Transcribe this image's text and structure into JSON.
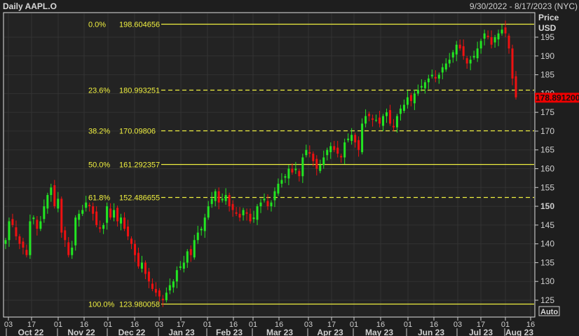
{
  "header": {
    "title": "Daily AAPL.O",
    "date_range": "9/30/2022 - 8/17/2023 (NYC)"
  },
  "price_axis": {
    "label": "Price",
    "currency": "USD",
    "auto_button": "Auto"
  },
  "colors": {
    "up": "#22e622",
    "down": "#ee1111",
    "fib_line": "#f0f040",
    "last_price_bg": "#ee0000"
  },
  "chart_data": {
    "type": "candlestick",
    "title": "Daily AAPL.O",
    "ylabel": "Price USD",
    "ylim": [
      123,
      199.5
    ],
    "y_ticks": [
      "125",
      "130",
      "135",
      "140",
      "145",
      "150",
      "155",
      "160",
      "165",
      "170",
      "175",
      "180",
      "185",
      "190",
      "195"
    ],
    "last_price": "178.891200",
    "fib_levels": [
      {
        "pct": "0.0%",
        "value": "198.604656",
        "price": 198.604656,
        "style": "solid"
      },
      {
        "pct": "23.6%",
        "value": "180.993251",
        "price": 180.993251,
        "style": "dashed"
      },
      {
        "pct": "38.2%",
        "value": "170.09806",
        "price": 170.09806,
        "style": "dashed"
      },
      {
        "pct": "50.0%",
        "value": "161.292357",
        "price": 161.292357,
        "style": "solid"
      },
      {
        "pct": "61.8%",
        "value": "152.486655",
        "price": 152.486655,
        "style": "dashed"
      },
      {
        "pct": "100.0%",
        "value": "123.980058",
        "price": 123.980058,
        "style": "solid"
      }
    ],
    "x_day_ticks": [
      "03",
      "17",
      "01",
      "16",
      "01",
      "16",
      "03",
      "17",
      "01",
      "16",
      "01",
      "16",
      "03",
      "17",
      "01",
      "16",
      "01",
      "16",
      "03",
      "17",
      "01",
      "16"
    ],
    "x_month_labels": [
      "Oct 22",
      "Nov 22",
      "Dec 22",
      "Jan 23",
      "Feb 23",
      "Mar 23",
      "Apr 23",
      "May 23",
      "Jun 23",
      "Jul 23",
      "Aug 23"
    ],
    "closes": [
      141,
      146,
      145,
      142,
      140,
      139,
      137,
      146,
      147,
      144,
      146,
      150,
      153,
      155,
      150,
      152,
      143,
      141,
      137,
      139,
      147,
      148,
      149,
      151,
      150,
      148,
      145,
      144,
      145,
      150,
      147,
      149,
      146,
      147,
      144,
      142,
      140,
      137,
      134,
      135,
      132,
      130,
      128,
      127,
      126,
      125,
      127,
      129,
      130,
      133,
      134,
      135,
      138,
      137,
      141,
      143,
      144,
      147,
      150,
      152,
      154,
      151,
      152,
      153,
      150,
      149,
      148,
      147,
      149,
      148,
      146,
      147,
      150,
      151,
      152,
      150,
      151,
      154,
      156,
      157,
      158,
      160,
      159,
      160,
      158,
      163,
      165,
      164,
      162,
      160,
      161,
      163,
      165,
      166,
      165,
      164,
      163,
      167,
      168,
      169,
      167,
      165,
      172,
      174,
      174,
      173,
      173,
      172,
      174,
      175,
      172,
      171,
      174,
      176,
      177,
      179,
      178,
      180,
      181,
      182,
      183,
      184,
      185,
      184,
      185,
      187,
      188,
      189,
      191,
      193,
      192,
      190,
      188,
      189,
      190,
      192,
      194,
      196,
      195,
      193,
      195,
      196,
      197,
      196,
      192,
      184,
      179
    ]
  }
}
